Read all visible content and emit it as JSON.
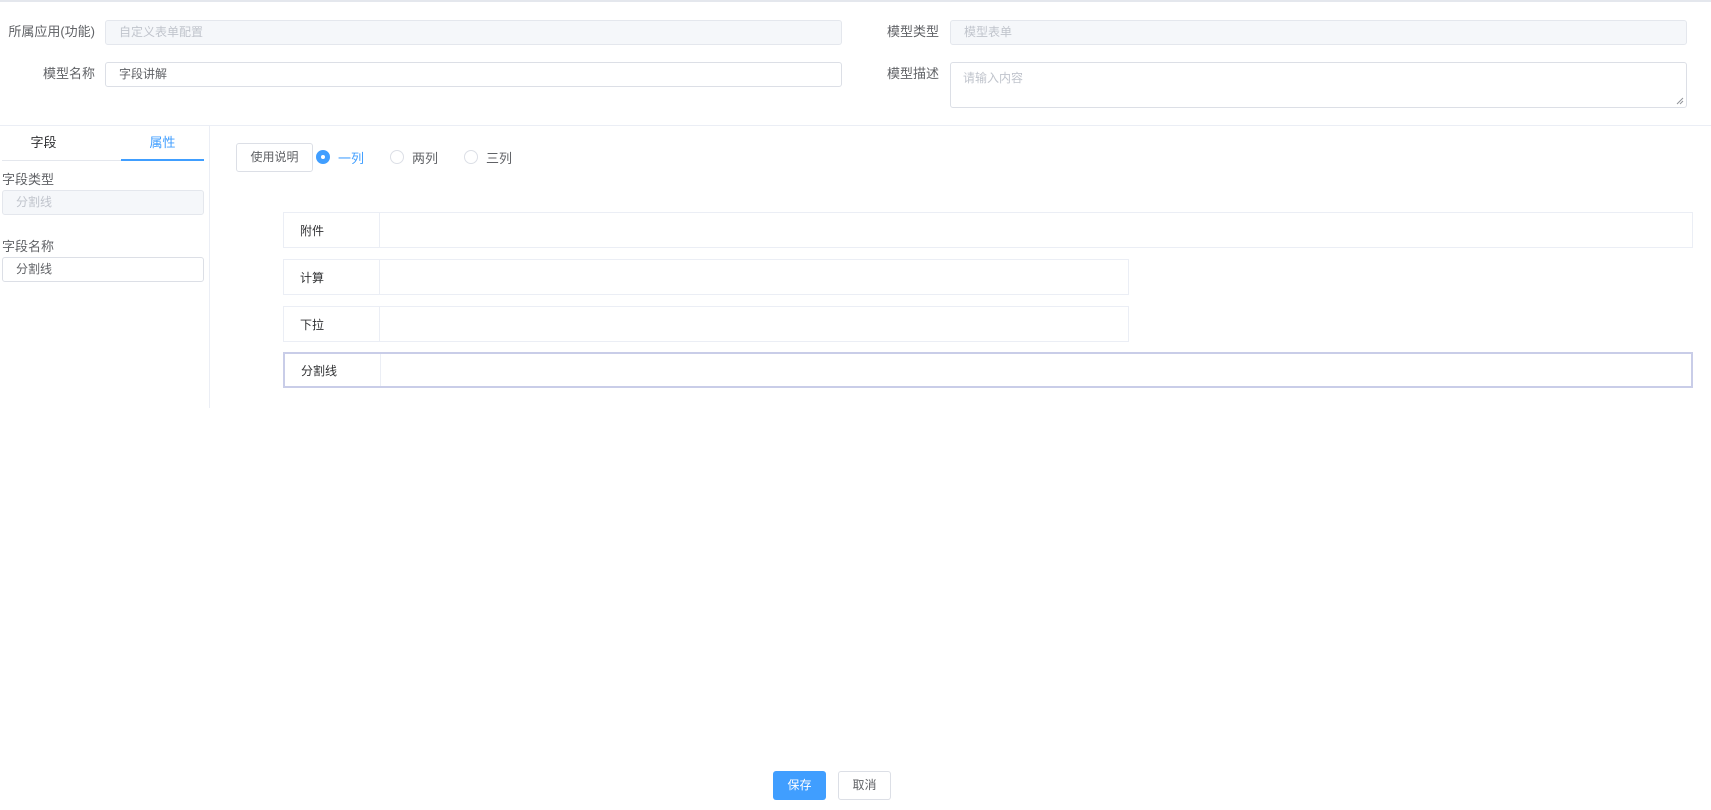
{
  "header": {
    "app_label": "所属应用(功能)",
    "app_value": "自定义表单配置",
    "type_label": "模型类型",
    "type_value": "模型表单",
    "name_label": "模型名称",
    "name_value": "字段讲解",
    "desc_label": "模型描述",
    "desc_placeholder": "请输入内容"
  },
  "sidebar": {
    "tabs": [
      {
        "label": "字段",
        "active": false
      },
      {
        "label": "属性",
        "active": true
      }
    ],
    "field_type_label": "字段类型",
    "field_type_value": "分割线",
    "field_name_label": "字段名称",
    "field_name_value": "分割线"
  },
  "toolbar": {
    "usage_button": "使用说明",
    "layout_options": [
      {
        "label": "一列",
        "checked": true
      },
      {
        "label": "两列",
        "checked": false
      },
      {
        "label": "三列",
        "checked": false
      }
    ]
  },
  "fields": [
    {
      "label": "附件",
      "full_width": true,
      "selected": false
    },
    {
      "label": "计算",
      "full_width": false,
      "selected": false
    },
    {
      "label": "下拉",
      "full_width": false,
      "selected": false
    },
    {
      "label": "分割线",
      "full_width": true,
      "selected": true
    }
  ],
  "footer": {
    "save_label": "保存",
    "cancel_label": "取消"
  },
  "colors": {
    "accent": "#409eff",
    "border": "#dcdfe6",
    "selected_border": "#c9cde8"
  }
}
